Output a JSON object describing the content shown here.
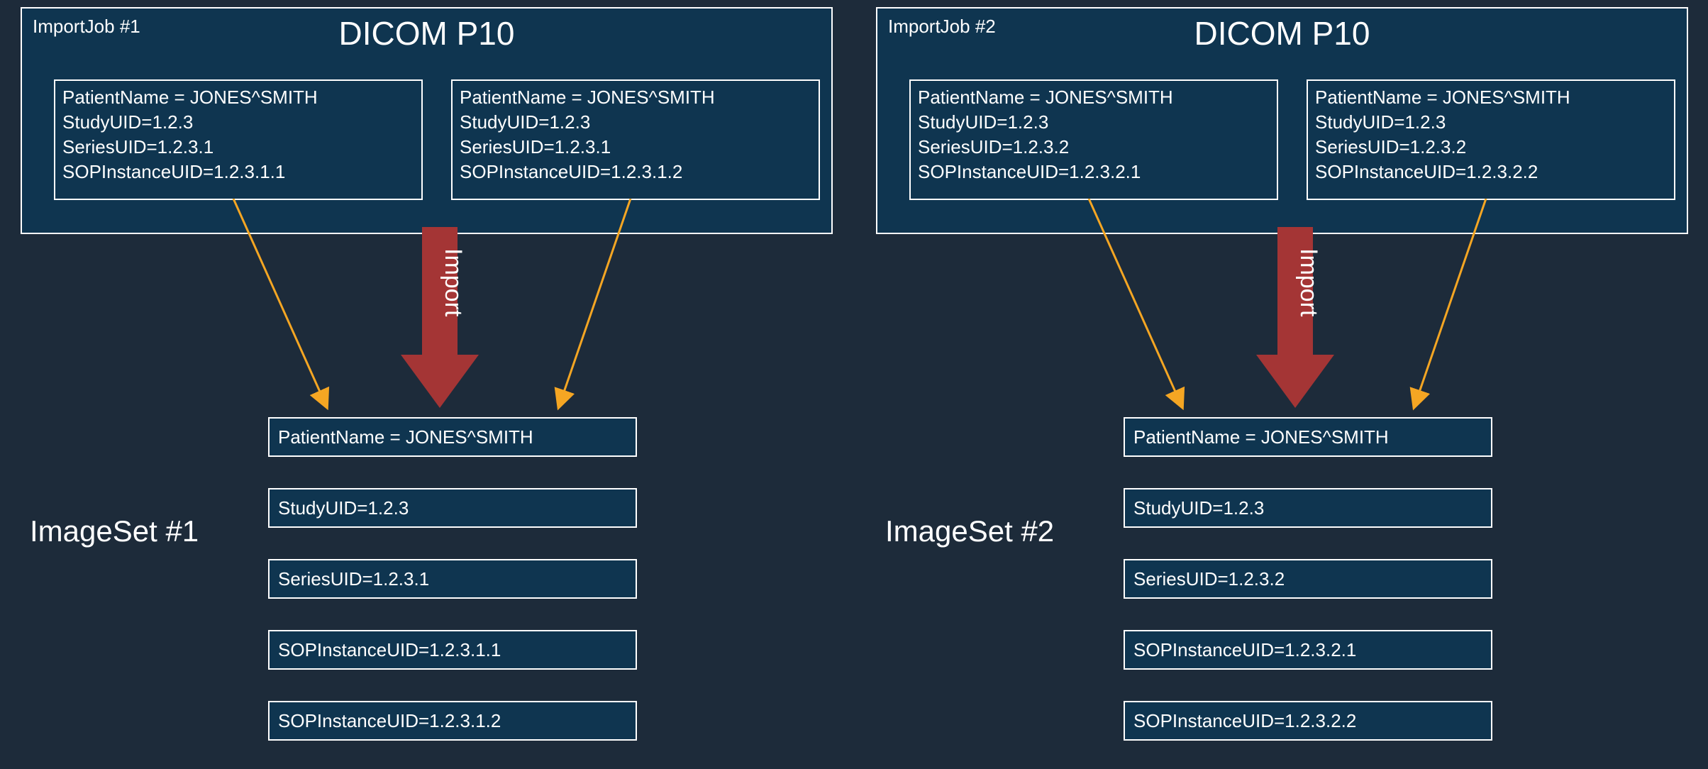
{
  "job1": {
    "label": "ImportJob #1",
    "title": "DICOM P10",
    "entry1": {
      "l1": "PatientName = JONES^SMITH",
      "l2": "StudyUID=1.2.3",
      "l3": "SeriesUID=1.2.3.1",
      "l4": "SOPInstanceUID=1.2.3.1.1"
    },
    "entry2": {
      "l1": "PatientName = JONES^SMITH",
      "l2": "StudyUID=1.2.3",
      "l3": "SeriesUID=1.2.3.1",
      "l4": "SOPInstanceUID=1.2.3.1.2"
    }
  },
  "job2": {
    "label": "ImportJob #2",
    "title": "DICOM P10",
    "entry1": {
      "l1": "PatientName = JONES^SMITH",
      "l2": "StudyUID=1.2.3",
      "l3": "SeriesUID=1.2.3.2",
      "l4": "SOPInstanceUID=1.2.3.2.1"
    },
    "entry2": {
      "l1": "PatientName = JONES^SMITH",
      "l2": "StudyUID=1.2.3",
      "l3": "SeriesUID=1.2.3.2",
      "l4": "SOPInstanceUID=1.2.3.2.2"
    }
  },
  "importLabel": "Import",
  "set1": {
    "label": "ImageSet #1",
    "r1": "PatientName = JONES^SMITH",
    "r2": "StudyUID=1.2.3",
    "r3": "SeriesUID=1.2.3.1",
    "r4": "SOPInstanceUID=1.2.3.1.1",
    "r5": "SOPInstanceUID=1.2.3.1.2"
  },
  "set2": {
    "label": "ImageSet #2",
    "r1": "PatientName = JONES^SMITH",
    "r2": "StudyUID=1.2.3",
    "r3": "SeriesUID=1.2.3.2",
    "r4": "SOPInstanceUID=1.2.3.2.1",
    "r5": "SOPInstanceUID=1.2.3.2.2"
  }
}
